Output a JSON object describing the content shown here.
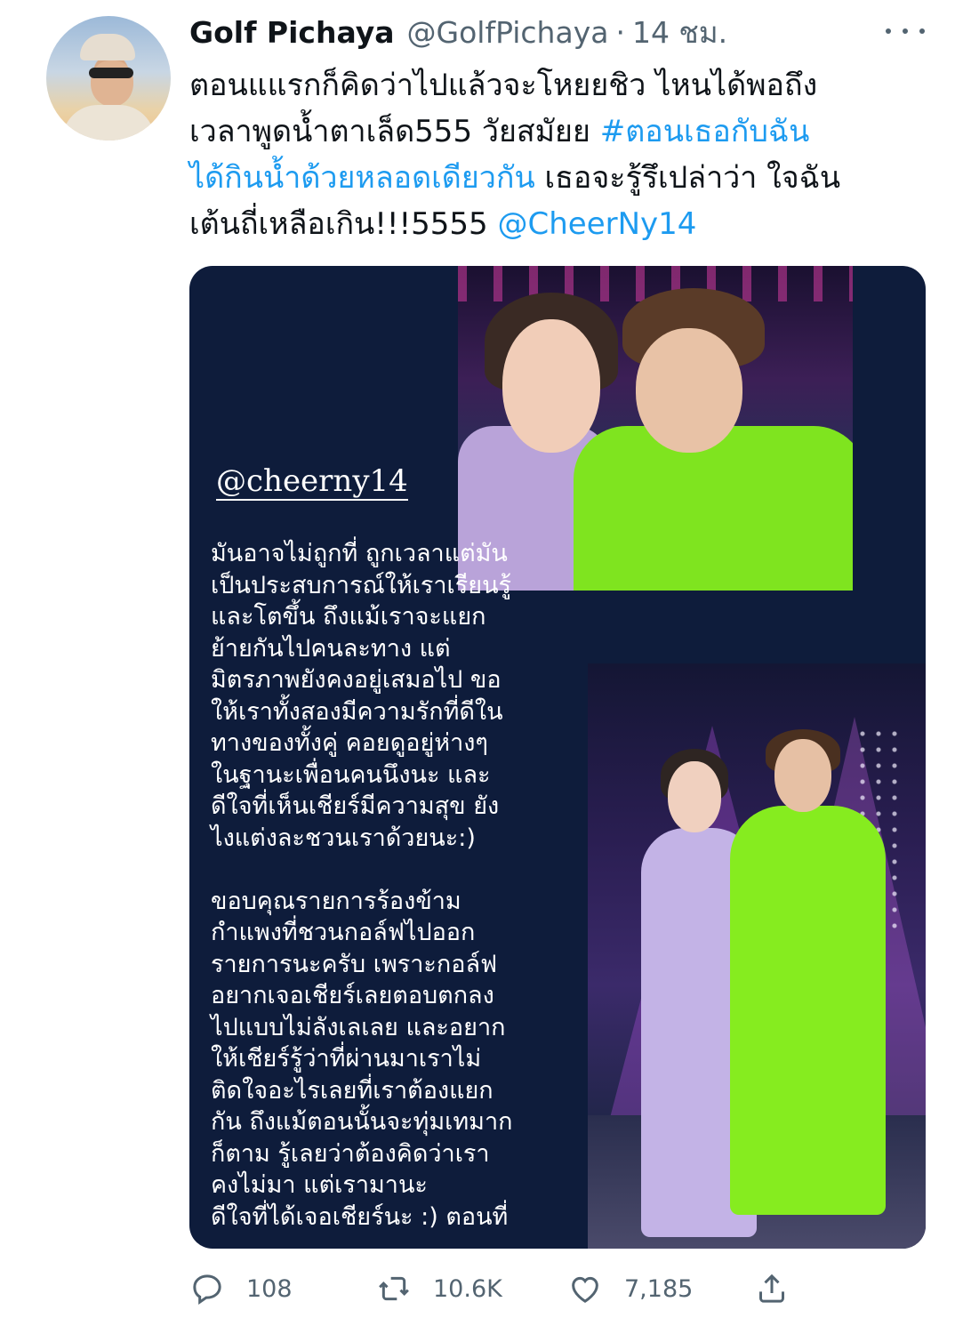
{
  "tweet": {
    "display_name": "Golf Pichaya",
    "handle": "@GolfPichaya",
    "separator": "·",
    "time": "14 ชม.",
    "text_lines": [
      [
        {
          "t": "ตอนแแรกก็คิดว่าไปแล้วจะโหยยชิว ไหนได้พอถึง",
          "link": false
        }
      ],
      [
        {
          "t": "เวลาพูดน้ำตาเล็ด555  วัยสมัยย ",
          "link": false
        },
        {
          "t": "#ตอนเธอกับฉัน",
          "link": true
        }
      ],
      [
        {
          "t": "ได้กินน้ำด้วยหลอดเดียวกัน",
          "link": true
        },
        {
          "t": " เธอจะรู้รึเปล่าว่า ใจฉัน",
          "link": false
        }
      ],
      [
        {
          "t": "เต้นถี่เหลือเกิน!!!5555 ",
          "link": false
        },
        {
          "t": "@CheerNy14",
          "link": true
        }
      ]
    ]
  },
  "media": {
    "story_handle": "@cheerny14",
    "story_paragraph_1": [
      "มันอาจไม่ถูกที่ ถูกเวลาแต่มัน",
      "เป็นประสบการณ์ให้เราเรียนรู้",
      "และโตขึ้น ถึงแม้เราจะแยก",
      "ย้ายกันไปคนละทาง แต่",
      "มิตรภาพยังคงอยู่เสมอไป ขอ",
      "ให้เราทั้งสองมีความรักที่ดีใน",
      "ทางของทั้งคู่ คอยดูอยู่ห่างๆ",
      "ในฐานะเพื่อนคนนึงนะ และ",
      "ดีใจที่เห็นเชียร์มีความสุข ยัง",
      "ไงแต่งละชวนเราด้วยนะ:)"
    ],
    "story_paragraph_2": [
      "ขอบคุณรายการร้องข้าม",
      "กำแพงที่ชวนกอล์ฟไปออก",
      "รายการนะครับ เพราะกอล์ฟ",
      "อยากเจอเชียร์เลยตอบตกลง",
      "ไปแบบไม่ลังเลเลย และอยาก",
      "ให้เชียร์รู้ว่าที่ผ่านมาเราไม่",
      "ติดใจอะไรเลยที่เราต้องแยก",
      "กัน ถึงแม้ตอนนั้นจะทุ่มเทมาก",
      "ก็ตาม รู้เลยว่าต้องคิดว่าเรา",
      "คงไม่มา แต่เรามานะ",
      "ดีใจที่ได้เจอเชียร์นะ :) ตอนที่"
    ]
  },
  "actions": {
    "reply_count": "108",
    "retweet_count": "10.6K",
    "like_count": "7,185",
    "icons": [
      "reply-icon",
      "retweet-icon",
      "like-icon",
      "share-icon"
    ]
  },
  "colors": {
    "link": "#1d9bf0",
    "secondary_text": "#536471",
    "media_bg": "#0e1c3b",
    "suit_green": "#7fe41f",
    "suit_lavender": "#c3b3e6"
  }
}
